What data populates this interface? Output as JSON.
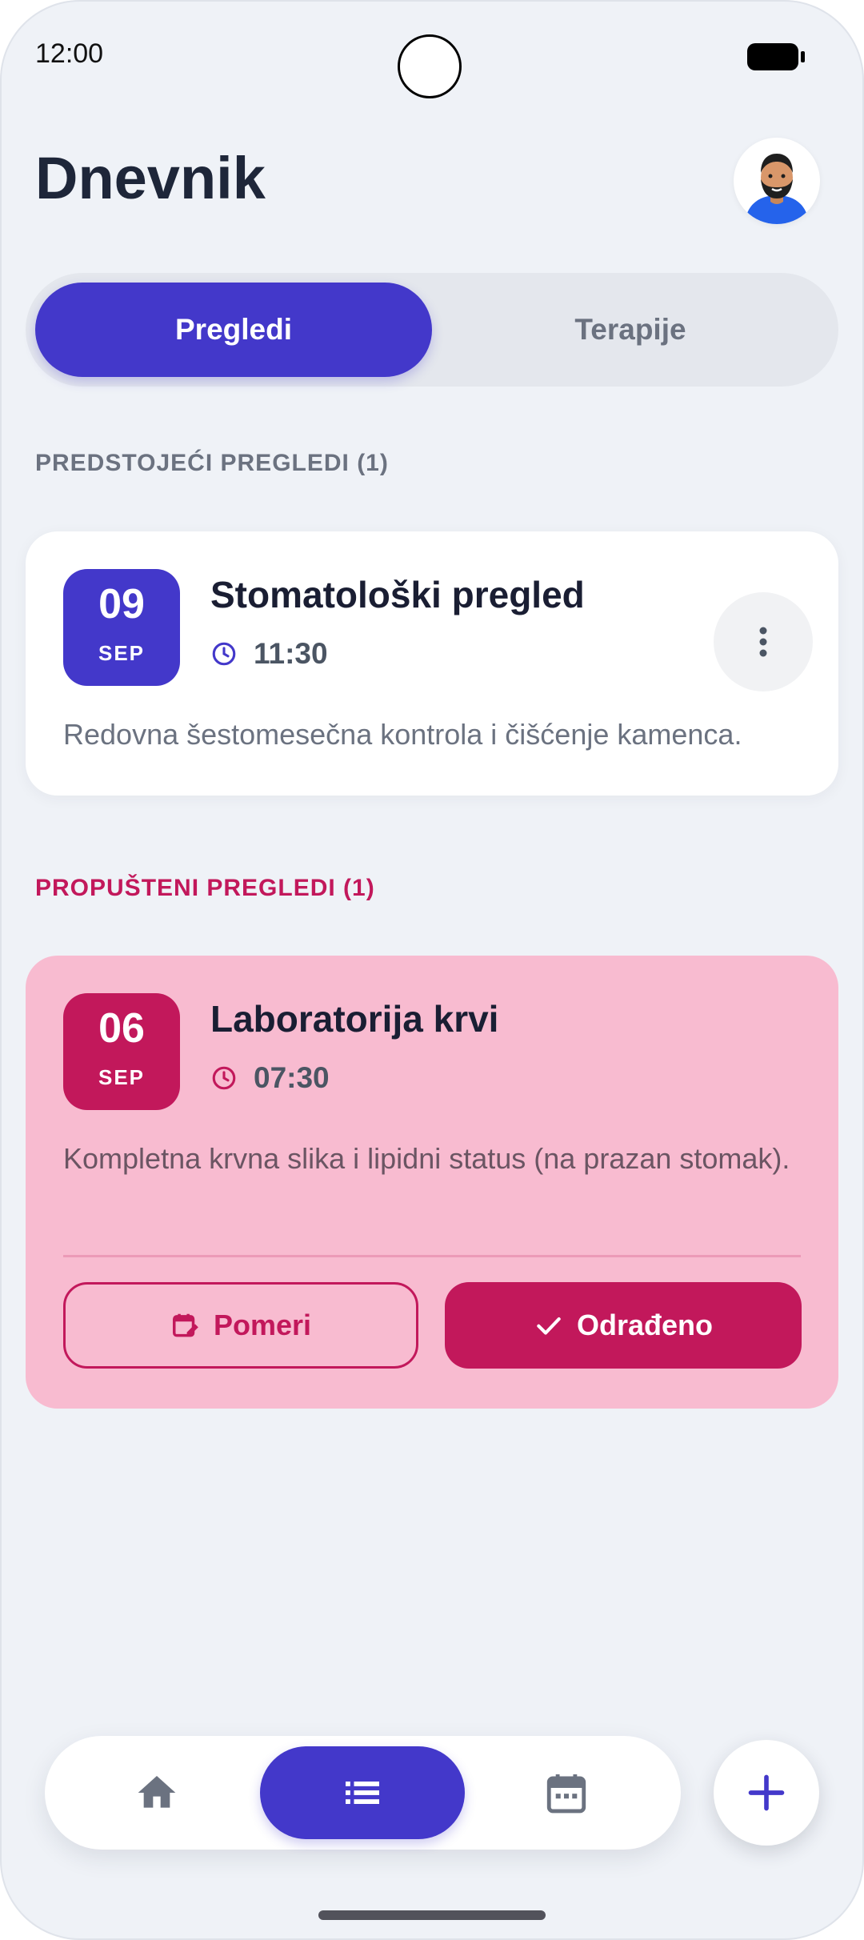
{
  "status_bar": {
    "time": "12:00"
  },
  "header": {
    "title": "Dnevnik"
  },
  "tabs": [
    {
      "label": "Pregledi",
      "active": true
    },
    {
      "label": "Terapije",
      "active": false
    }
  ],
  "upcoming": {
    "section_label": "PREDSTOJEĆI PREGLEDI (1)",
    "items": [
      {
        "day": "09",
        "month": "SEP",
        "title": "Stomatološki pregled",
        "time": "11:30",
        "description": "Redovna šestomesečna kontrola i čišćenje kamenca."
      }
    ]
  },
  "missed": {
    "section_label": "PROPUŠTENI PREGLEDI (1)",
    "items": [
      {
        "day": "06",
        "month": "SEP",
        "title": "Laboratorija krvi",
        "time": "07:30",
        "description": "Kompletna krvna slika i lipidni status (na prazan stomak).",
        "reschedule_label": "Pomeri",
        "done_label": "Odrađeno"
      }
    ]
  },
  "bottom_nav": {
    "items": [
      {
        "icon": "home-icon",
        "active": false
      },
      {
        "icon": "list-icon",
        "active": true
      },
      {
        "icon": "calendar-icon",
        "active": false
      }
    ],
    "fab_icon": "plus-icon"
  },
  "colors": {
    "primary": "#4338ca",
    "danger": "#c2185b",
    "danger_bg": "#f8bbd0",
    "background": "#eff2f7"
  }
}
